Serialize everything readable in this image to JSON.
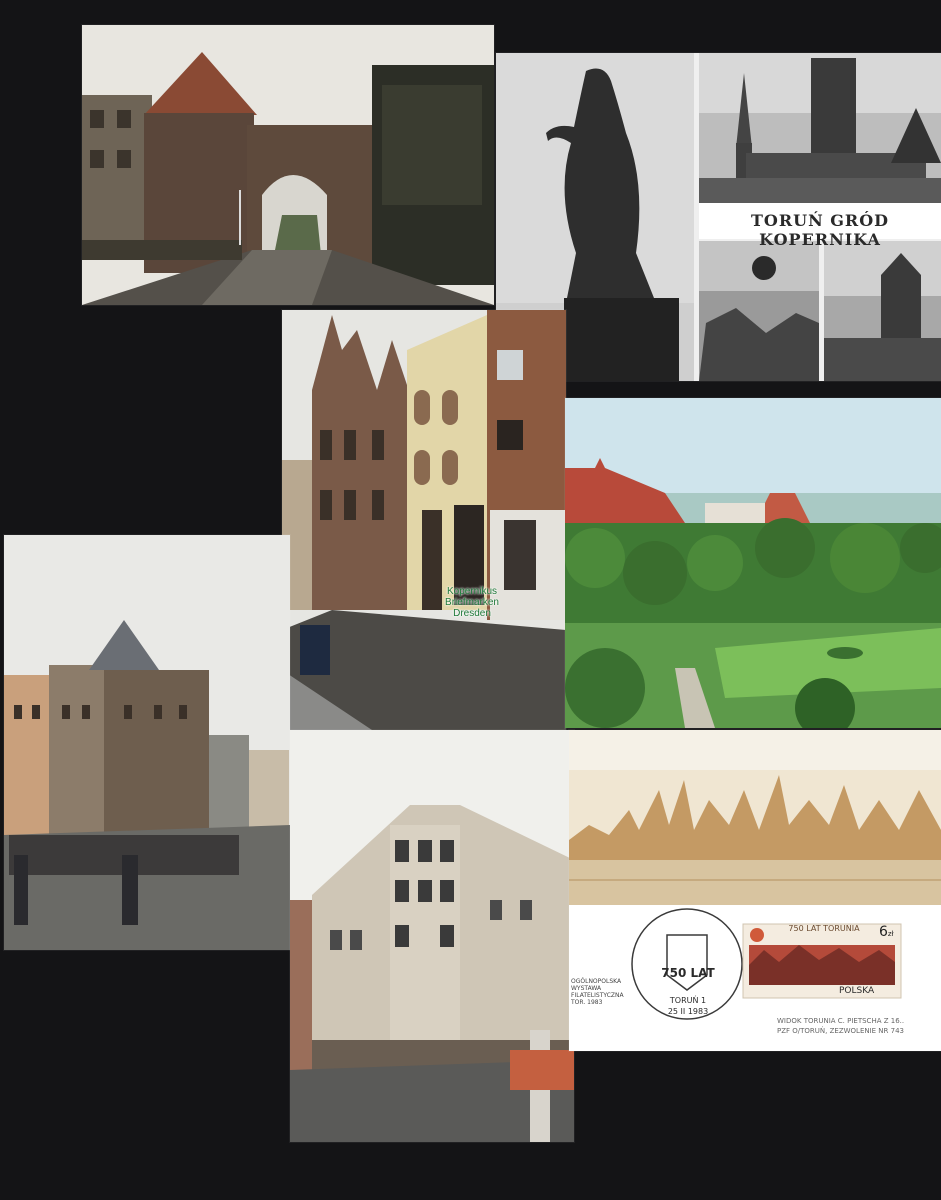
{
  "photos": [
    {
      "id": "gate-tower",
      "description_color": "#5a4a3c"
    },
    {
      "id": "copernicus-postcard",
      "description_color": "#c8c8c8"
    },
    {
      "id": "gothic-street",
      "description_color": "#6a5040"
    },
    {
      "id": "park-aerial",
      "description_color": "#5f9a4a"
    },
    {
      "id": "market-square",
      "description_color": "#8a8070"
    },
    {
      "id": "corner-building",
      "description_color": "#d8d0c4"
    },
    {
      "id": "panorama-souvenir",
      "description_color": "#f3eee4"
    }
  ],
  "postcard": {
    "title": "TORUŃ GRÓD KOPERNIKA"
  },
  "watermark": {
    "line1": "Kopernikus",
    "line2": "Briefmarken",
    "line3": "Dresden"
  },
  "souvenir": {
    "stamp_value": "6",
    "stamp_unit": "zł",
    "stamp_country": "POLSKA",
    "stamp_top_text": "750 LAT TORUNIA",
    "postmark_big": "750 LAT",
    "postmark_city": "TORUŃ 1",
    "postmark_date": "25 II 1983",
    "side_text_1": "OGÓLNOPOLSKA",
    "side_text_2": "WYSTAWA",
    "side_text_3": "FILATELISTYCZNA",
    "side_text_4": "TOR. 1983",
    "caption_line1": "WIDOK TORUNIA C. PIETSCHA Z 16..",
    "caption_line2": "PZF O/TORUŃ, ZEZWOLENIE NR 743"
  }
}
